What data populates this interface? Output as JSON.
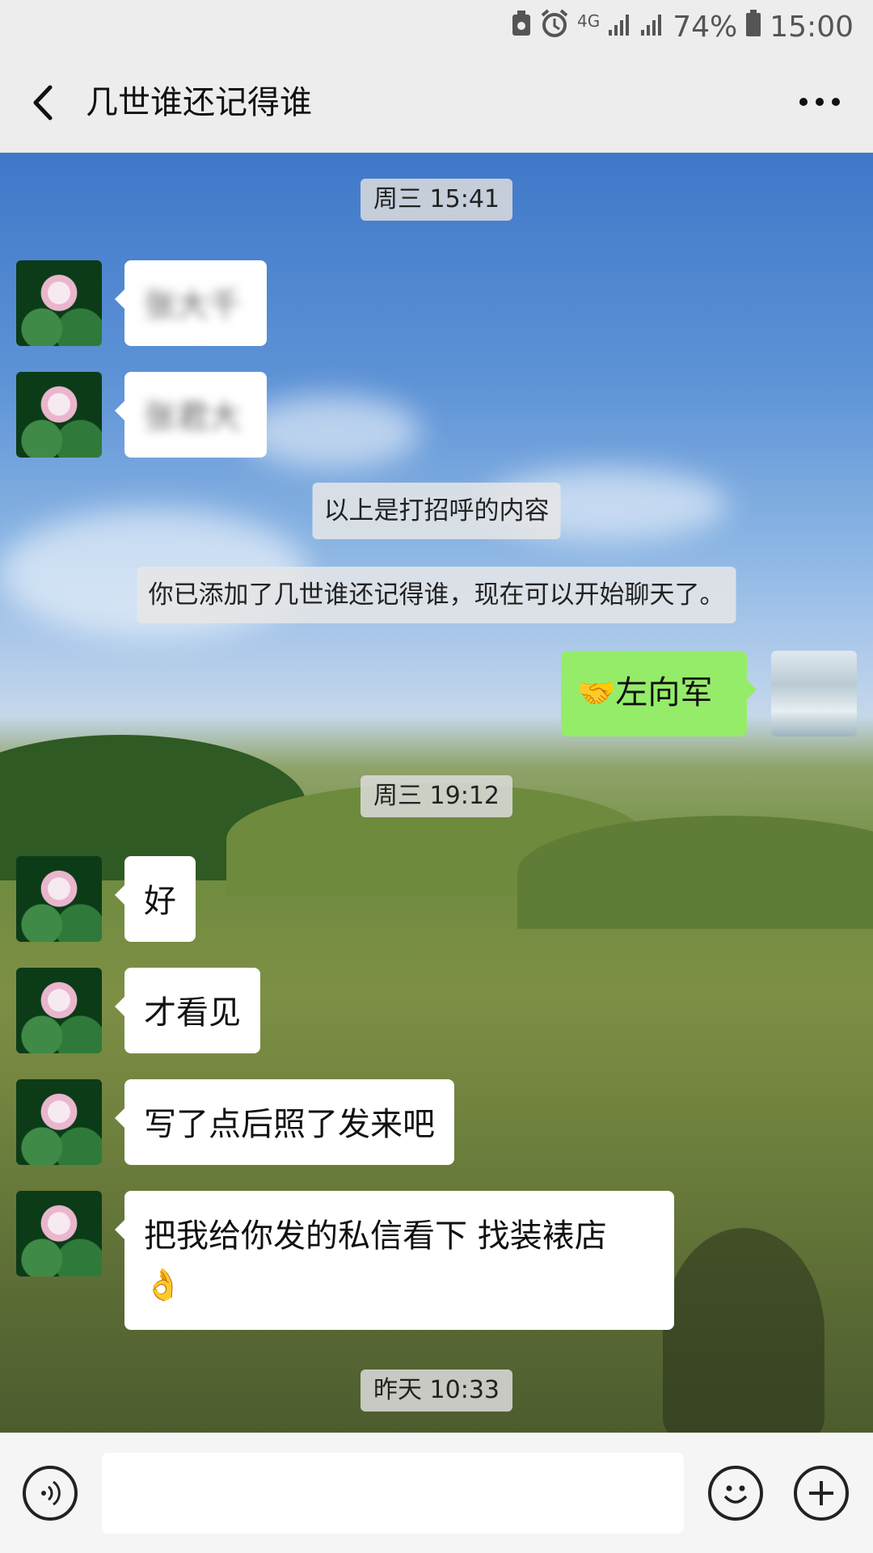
{
  "status_bar": {
    "network": "4G",
    "battery": "74%",
    "time": "15:00"
  },
  "nav": {
    "title": "几世谁还记得谁",
    "back_icon": "chevron-left-icon",
    "more_icon": "more-dots-icon"
  },
  "chat": {
    "timestamps": [
      "周三 15:41",
      "周三 19:12",
      "昨天 10:33"
    ],
    "blurred_messages": [
      "张大千",
      "张君大"
    ],
    "system_messages": [
      "以上是打招呼的内容",
      "你已添加了几世谁还记得谁，现在可以开始聊天了。"
    ],
    "sent": {
      "emoji": "🤝",
      "text": "左向军"
    },
    "received": [
      "好",
      "才看见",
      "写了点后照了发来吧",
      "把我给你发的私信看下 找装裱店"
    ],
    "received_emoji": "👌"
  },
  "input_bar": {
    "voice_icon": "voice-icon",
    "emoji_icon": "smiley-icon",
    "plus_icon": "plus-icon"
  },
  "colors": {
    "sent_bubble": "#95ec69",
    "received_bubble": "#ffffff",
    "bar_bg": "#ededed"
  }
}
